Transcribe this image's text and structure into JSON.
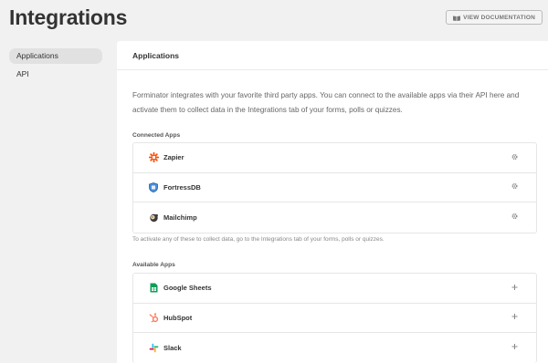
{
  "header": {
    "title": "Integrations",
    "doc_button": "VIEW DOCUMENTATION",
    "doc_icon": "book-icon"
  },
  "sidebar": {
    "items": [
      {
        "label": "Applications",
        "active": true
      },
      {
        "label": "API",
        "active": false
      }
    ]
  },
  "main": {
    "panel_title": "Applications",
    "intro": "Forminator integrates with your favorite third party apps. You can connect to the available apps via their API here and activate them to collect data in the Integrations tab of your forms, polls or quizzes.",
    "connected": {
      "label": "Connected Apps",
      "apps": [
        {
          "name": "Zapier",
          "icon": "zapier-icon",
          "action_icon": "gear-icon"
        },
        {
          "name": "FortressDB",
          "icon": "fortressdb-icon",
          "action_icon": "gear-icon"
        },
        {
          "name": "Mailchimp",
          "icon": "mailchimp-icon",
          "action_icon": "gear-icon"
        }
      ],
      "note": "To activate any of these to collect data, go to the Integrations tab of your forms, polls or quizzes."
    },
    "available": {
      "label": "Available Apps",
      "apps": [
        {
          "name": "Google Sheets",
          "icon": "google-sheets-icon",
          "action_icon": "plus-icon"
        },
        {
          "name": "HubSpot",
          "icon": "hubspot-icon",
          "action_icon": "plus-icon"
        },
        {
          "name": "Slack",
          "icon": "slack-icon",
          "action_icon": "plus-icon"
        }
      ]
    }
  },
  "colors": {
    "zapier": "#ff4a00",
    "fortressdb": "#1a5fa8",
    "sheets": "#0f9d58",
    "hubspot": "#ff7a59"
  }
}
